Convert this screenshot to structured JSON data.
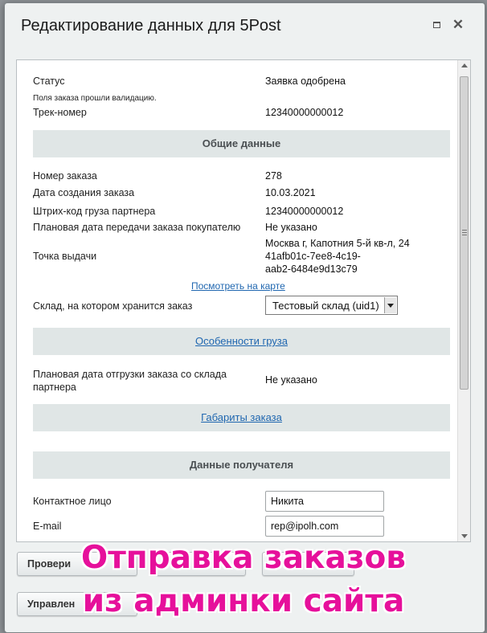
{
  "dialog": {
    "title": "Редактирование данных для 5Post",
    "maximize_icon": "maximize-icon",
    "close_icon": "close-icon",
    "close_glyph": "✕"
  },
  "status": {
    "label": "Статус",
    "value": "Заявка одобрена",
    "note": "Поля заказа прошли валидацию.",
    "track_label": "Трек-номер",
    "track_value": "12340000000012"
  },
  "general": {
    "header": "Общие данные",
    "rows": [
      {
        "label": "Номер заказа",
        "value": "278"
      },
      {
        "label": "Дата создания заказа",
        "value": "10.03.2021"
      },
      {
        "label": "Штрих-код груза партнера",
        "value": "12340000000012"
      },
      {
        "label": "Плановая дата передачи заказа покупателю",
        "value": "Не указано"
      }
    ],
    "pickup_label": "Точка выдачи",
    "pickup_lines": [
      "Москва г, Капотния 5-й кв-л, 24",
      "41afb01c-7ee8-4c19-",
      "aab2-6484e9d13c79"
    ],
    "map_link": "Посмотреть на карте",
    "warehouse_label": "Склад, на котором хранится заказ",
    "warehouse_value": "Тестовый склад (uid1)"
  },
  "cargo": {
    "link": "Особенности груза",
    "ship_label_line1": "Плановая дата отгрузки заказа со склада",
    "ship_label_line2": "партнера",
    "ship_value": "Не указано",
    "dimensions_link": "Габариты заказа"
  },
  "recipient": {
    "header": "Данные получателя",
    "contact_label": "Контактное лицо",
    "contact_value": "Никита",
    "email_label": "E-mail",
    "email_value": "rep@ipolh.com"
  },
  "buttons": {
    "check": "Провери",
    "manage": "Управлен"
  },
  "overlay": {
    "line1": "Отправка заказов",
    "line2": "из админки сайта"
  }
}
